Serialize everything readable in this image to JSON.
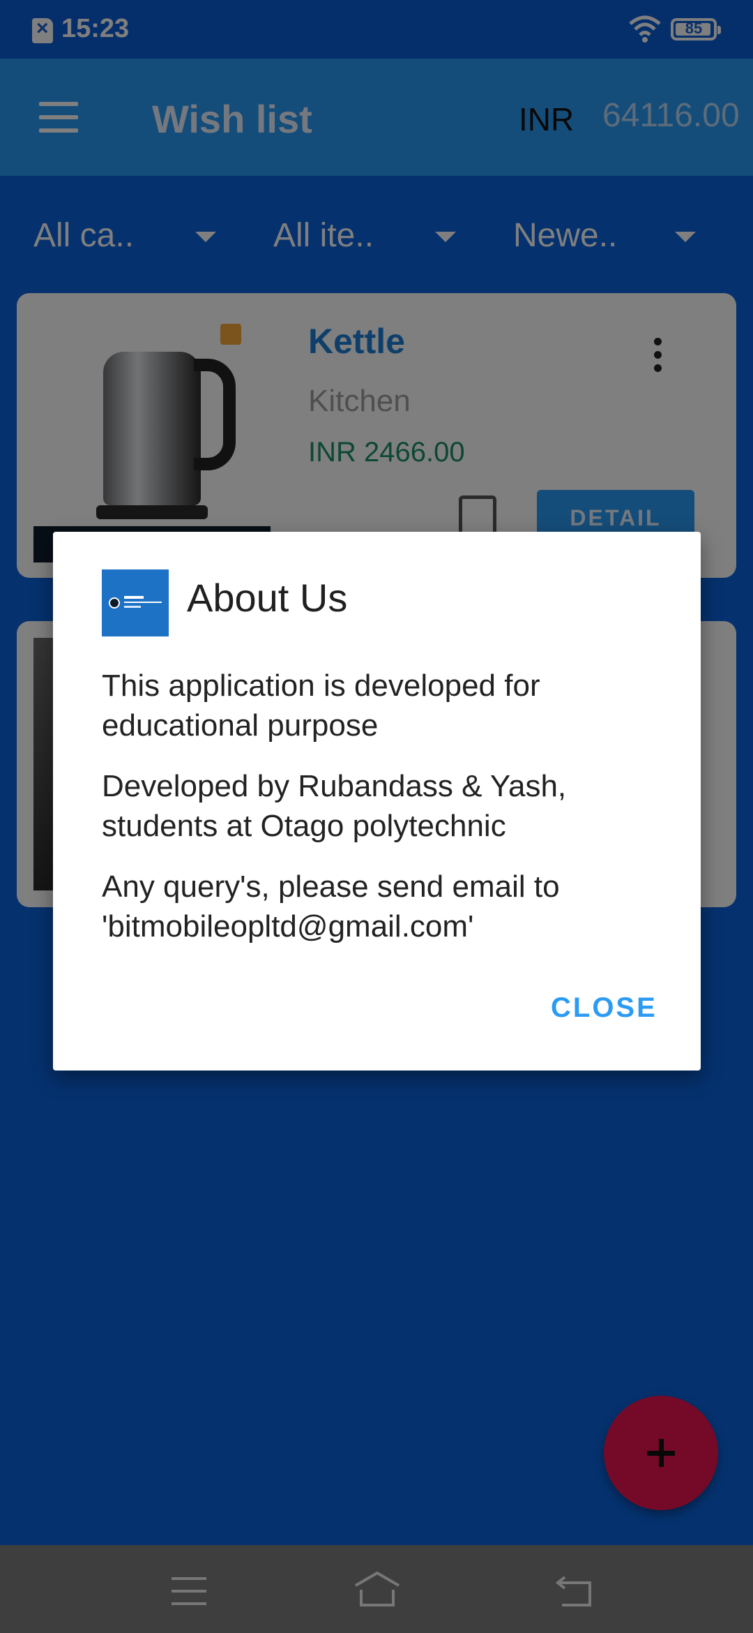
{
  "status_bar": {
    "time": "15:23",
    "battery_level": "85"
  },
  "app_bar": {
    "title": "Wish list",
    "currency": "INR",
    "total": "64116.00"
  },
  "filters": [
    {
      "label": "All ca.."
    },
    {
      "label": "All ite.."
    },
    {
      "label": "Newe.."
    }
  ],
  "items": [
    {
      "name": "Kettle",
      "category": "Kitchen",
      "price": "INR 2466.00",
      "detail_label": "DETAIL"
    }
  ],
  "dialog": {
    "title": "About Us",
    "paragraphs": [
      "This application is developed for educational purpose",
      "Developed by Rubandass & Yash, students at Otago polytechnic",
      "Any query's, please send email to 'bitmobileopltd@gmail.com'"
    ],
    "close_label": "CLOSE"
  },
  "colors": {
    "primary": "#2b9bf4",
    "background": "#0a63dc",
    "fab": "#e8154f",
    "price": "#1a8f6a"
  }
}
